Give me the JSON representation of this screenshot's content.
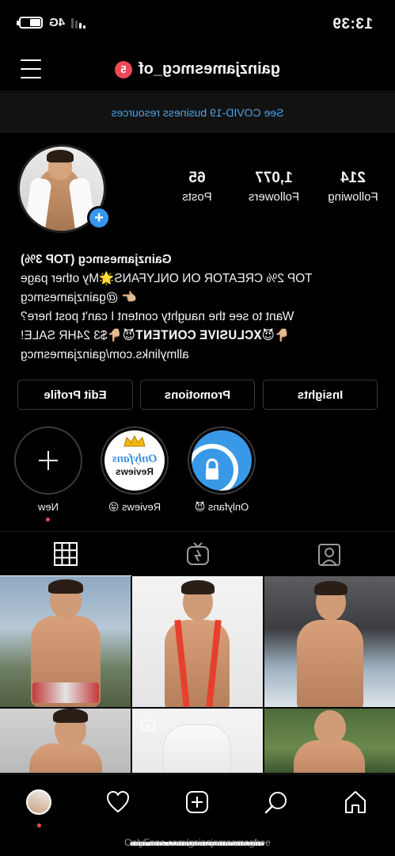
{
  "status_bar": {
    "time": "13:39",
    "network": "4G"
  },
  "header": {
    "username": "gainzjamesmcg_of",
    "notification_count": "5"
  },
  "banner": {
    "covid_link": "See COVID-19 business resources"
  },
  "stats": {
    "posts": {
      "value": "65",
      "label": "Posts"
    },
    "followers": {
      "value": "1,077",
      "label": "Followers"
    },
    "following": {
      "value": "214",
      "label": "Following"
    }
  },
  "bio": {
    "name": "Gainzjamesmcg (TOP 3%)",
    "line1": "TOP 2% CREATOR ON ONLYFANS🌟My other page",
    "line2": "👉🏼 @gainzjamesmcg",
    "line3": "Want to see the naughty content I can't post here?",
    "line4": "👇🏼😈𝐗𝐂𝐋𝐔𝐒𝐈𝐕𝐄 𝐂𝐎𝐍𝐓𝐄𝐍𝐓😈👇🏼$3 24HR SALE!",
    "link": "allmylinks.com/gainzjamesmcg"
  },
  "buttons": {
    "edit_profile": "Edit Profile",
    "promotions": "Promotions",
    "insights": "Insights"
  },
  "highlights": [
    {
      "label": "New"
    },
    {
      "label": "Reviews 😜"
    },
    {
      "label": "Onlyfans 😈"
    }
  ],
  "highlight_reviews_text": {
    "top": "Onlyfans",
    "bottom": "Reviews"
  },
  "tabs": [
    {
      "name": "grid",
      "icon": "grid-icon",
      "active": true
    },
    {
      "name": "igtv",
      "icon": "igtv-icon",
      "active": false
    },
    {
      "name": "tagged",
      "icon": "tagged-icon",
      "active": false
    }
  ],
  "colors": {
    "accent": "#3897f0",
    "link": "#4aa3e8",
    "badge": "#ed4956",
    "background": "#000000"
  },
  "watermark": "OnlyFans.com/gainzjamesmcgfree"
}
